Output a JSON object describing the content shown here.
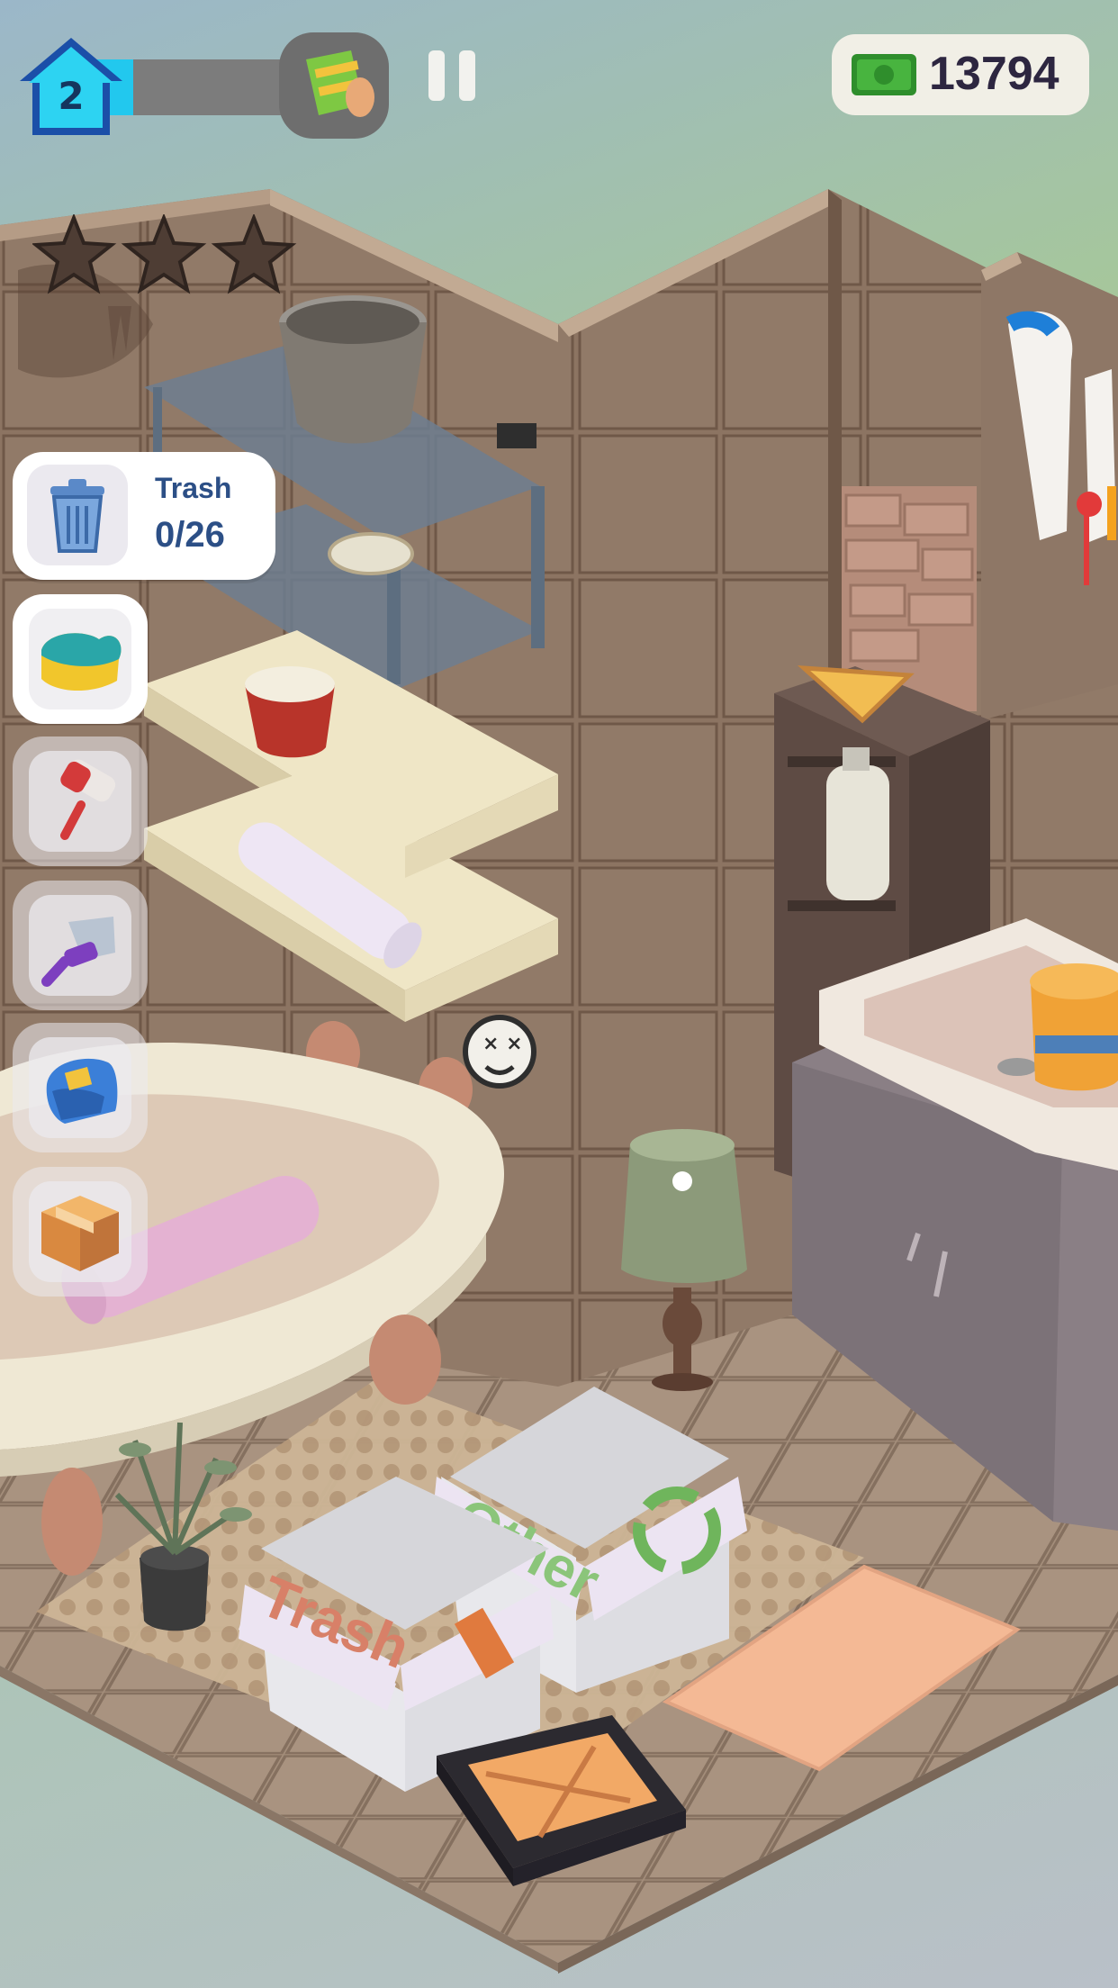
{
  "hud": {
    "level": "2",
    "level_progress": 0.2,
    "cash": "13794",
    "stars_total": 3,
    "stars_earned": 0
  },
  "trash": {
    "title": "Trash",
    "count": "0/26"
  },
  "tools": [
    {
      "name": "sponge-tool",
      "icon": "sponge-icon",
      "active": true
    },
    {
      "name": "paint-roller-tool",
      "icon": "paint-roller-icon",
      "active": false
    },
    {
      "name": "scraper-tool",
      "icon": "scraper-icon",
      "active": false
    },
    {
      "name": "furniture-tool",
      "icon": "armchair-icon",
      "active": false
    },
    {
      "name": "box-tool",
      "icon": "cardboard-box-icon",
      "active": false
    }
  ],
  "scene": {
    "trash_box_label": "Trash",
    "other_box_label": "Other"
  }
}
